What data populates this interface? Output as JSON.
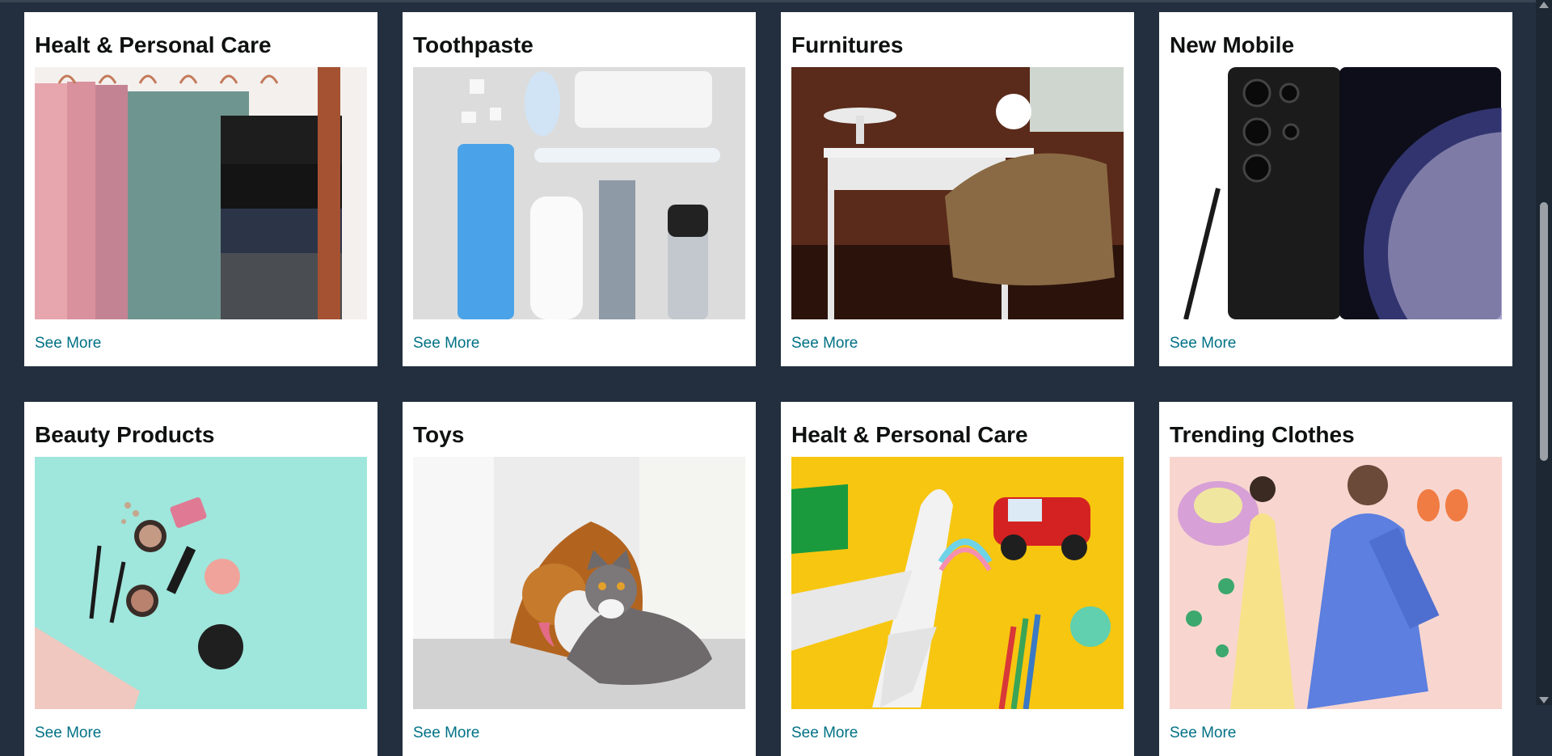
{
  "cards": [
    {
      "title": "Healt & Personal Care",
      "link": "See More",
      "image": "hanging-scarves-image"
    },
    {
      "title": "Toothpaste",
      "link": "See More",
      "image": "toiletries-image"
    },
    {
      "title": "Furnitures",
      "link": "See More",
      "image": "desk-chair-image"
    },
    {
      "title": "New Mobile",
      "link": "See More",
      "image": "smartphone-image"
    },
    {
      "title": "Beauty Products",
      "link": "See More",
      "image": "makeup-image"
    },
    {
      "title": "Toys",
      "link": "See More",
      "image": "dog-cat-image"
    },
    {
      "title": "Healt & Personal Care",
      "link": "See More",
      "image": "toy-plane-car-image"
    },
    {
      "title": "Trending Clothes",
      "link": "See More",
      "image": "fashion-image"
    }
  ],
  "colors": {
    "page_bg": "#232f3e",
    "link": "#007185",
    "title": "#0f1111"
  }
}
